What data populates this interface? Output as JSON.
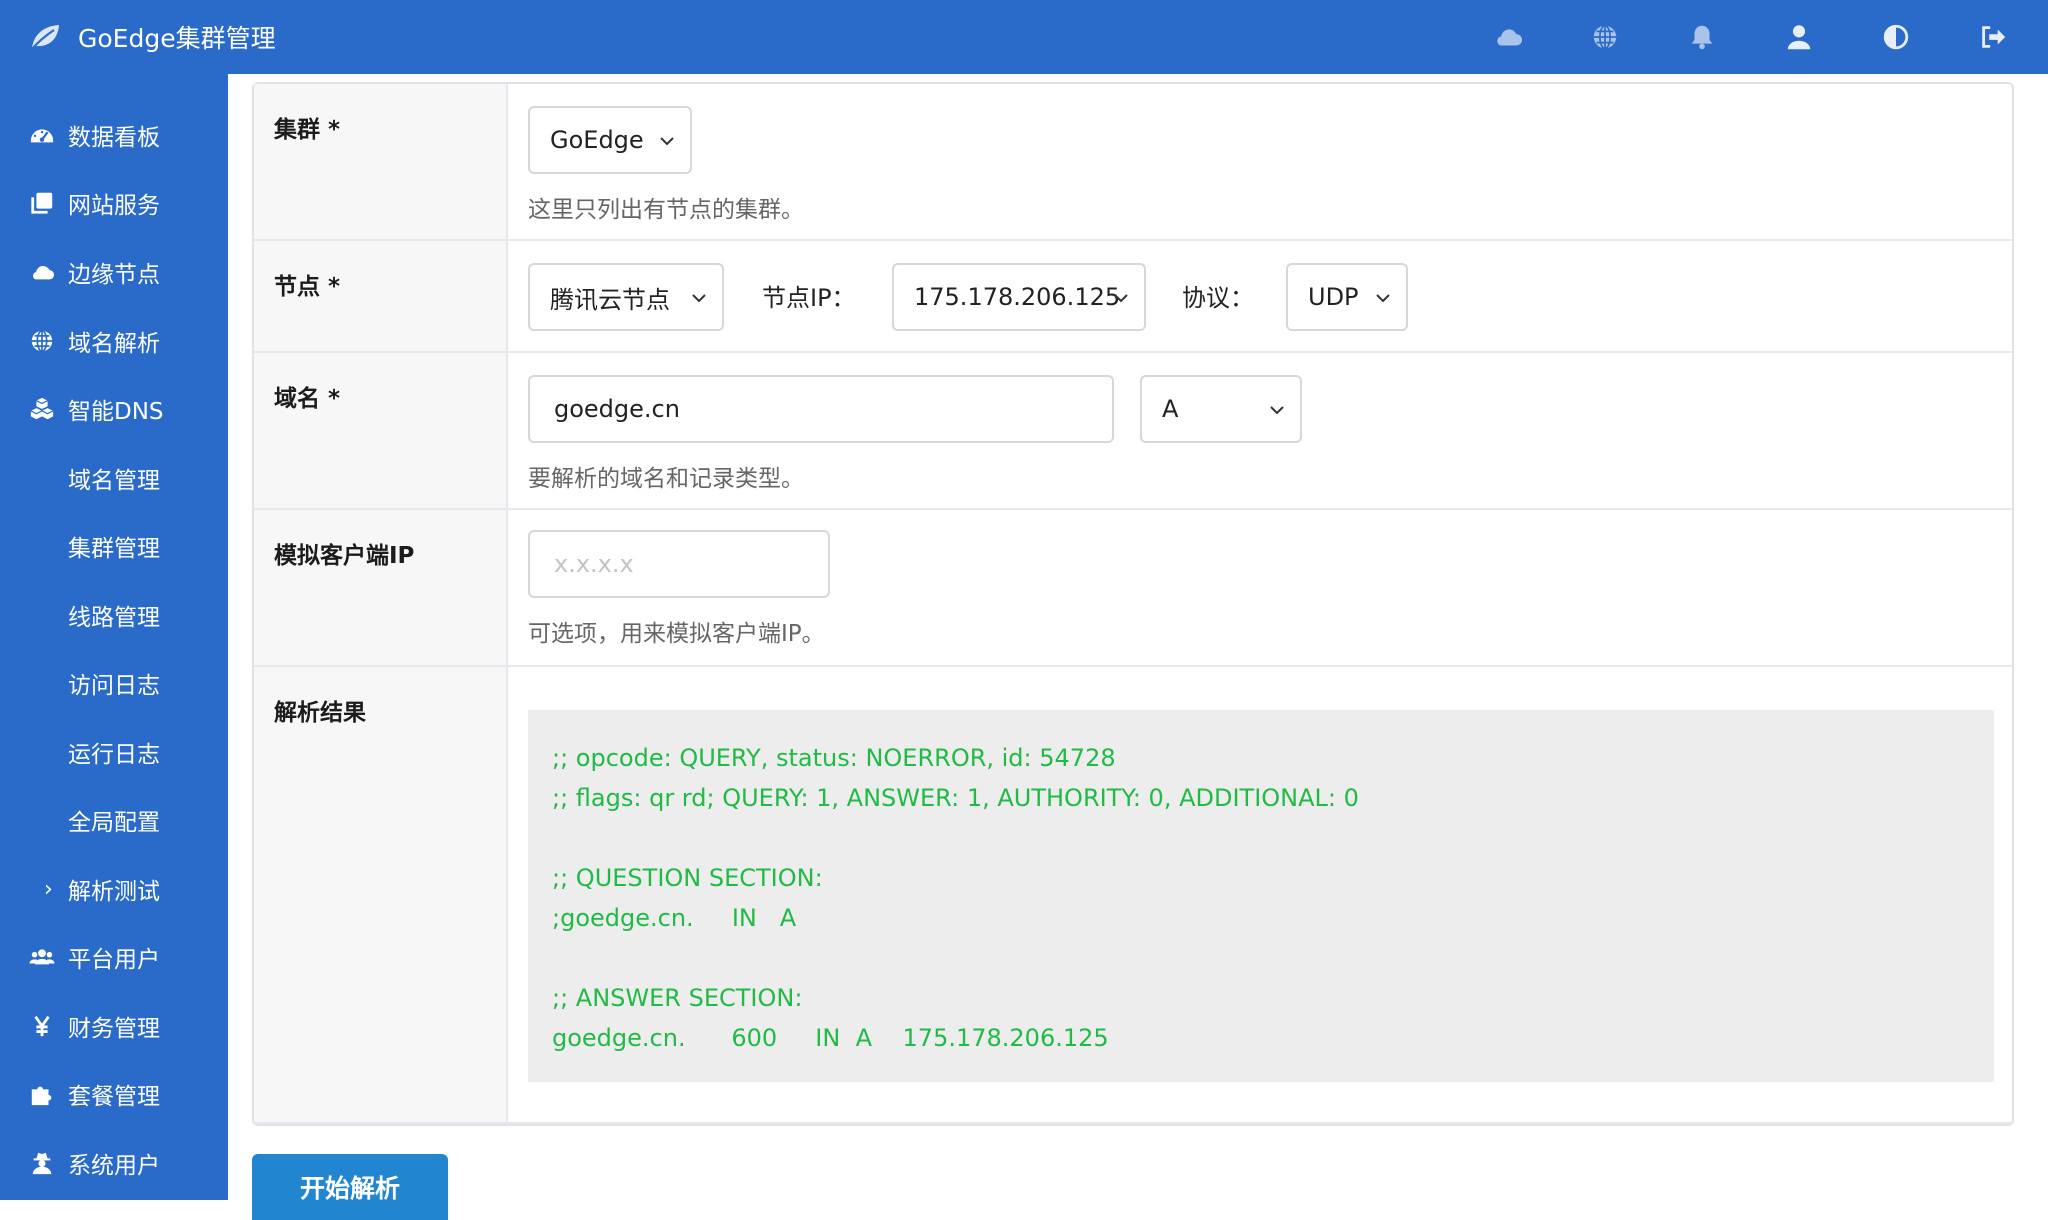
{
  "app": {
    "title": "GoEdge集群管理"
  },
  "topbar": {
    "icons": [
      "cloud-icon",
      "globe-icon",
      "bell-icon",
      "user-icon",
      "contrast-icon",
      "logout-icon"
    ]
  },
  "sidebar": {
    "items": [
      {
        "label": "数据看板",
        "icon": "dashboard-icon"
      },
      {
        "label": "网站服务",
        "icon": "copy-icon"
      },
      {
        "label": "边缘节点",
        "icon": "cloud-icon"
      },
      {
        "label": "域名解析",
        "icon": "globe-icon"
      },
      {
        "label": "智能DNS",
        "icon": "cubes-icon"
      },
      {
        "label": "域名管理"
      },
      {
        "label": "集群管理"
      },
      {
        "label": "线路管理"
      },
      {
        "label": "访问日志"
      },
      {
        "label": "运行日志"
      },
      {
        "label": "全局配置"
      },
      {
        "label": "解析测试",
        "active": true
      },
      {
        "label": "平台用户",
        "icon": "users-icon"
      },
      {
        "label": "财务管理",
        "icon": "yen-icon"
      },
      {
        "label": "套餐管理",
        "icon": "puzzle-icon"
      },
      {
        "label": "系统用户",
        "icon": "user-secret-icon"
      }
    ]
  },
  "form": {
    "cluster": {
      "label": "集群 *",
      "value": "GoEdge",
      "hint": "这里只列出有节点的集群。"
    },
    "node": {
      "label": "节点 *",
      "value": "腾讯云节点",
      "ip_label": "节点IP：",
      "ip_value": "175.178.206.125",
      "protocol_label": "协议：",
      "protocol_value": "UDP"
    },
    "domain": {
      "label": "域名 *",
      "value": "goedge.cn",
      "record_type": "A",
      "hint": "要解析的域名和记录类型。"
    },
    "client_ip": {
      "label": "模拟客户端IP",
      "placeholder": "x.x.x.x",
      "hint": "可选项，用来模拟客户端IP。"
    },
    "result": {
      "label": "解析结果",
      "lines": [
        ";; opcode: QUERY, status: NOERROR, id: 54728",
        ";; flags: qr rd; QUERY: 1, ANSWER: 1, AUTHORITY: 0, ADDITIONAL: 0",
        "",
        ";; QUESTION SECTION:",
        ";goedge.cn.     IN   A",
        "",
        ";; ANSWER SECTION:",
        "goedge.cn.      600     IN  A    175.178.206.125"
      ]
    },
    "submit_label": "开始解析"
  },
  "colors": {
    "primary": "#2a6ac8",
    "button": "#2185d0",
    "result_text": "#21ba45",
    "result_bg": "#ededed"
  }
}
